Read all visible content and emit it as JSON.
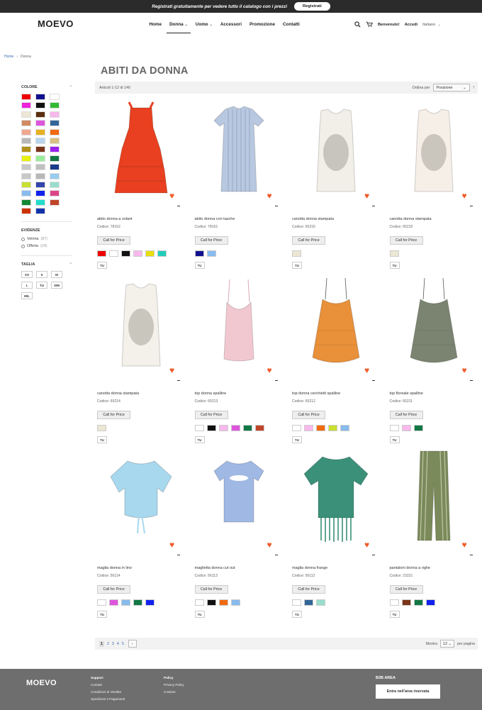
{
  "banner": {
    "text": "Registrati gratuitamente per vedere tutto il catalogo con i prezzi",
    "button": "Registrati"
  },
  "header": {
    "logo": "MOEVO",
    "nav": [
      "Home",
      "Donna",
      "Uomo",
      "Accessori",
      "Promozione",
      "Contatti"
    ],
    "welcome": "Benvenuto!",
    "login": "Accedi",
    "language": "Italiano"
  },
  "breadcrumb": {
    "home": "Home",
    "sep": "›",
    "current": "Donna"
  },
  "page_title": "ABITI DA DONNA",
  "toolbar": {
    "amount": "Articoli 1-12 di 140",
    "sort_label": "Ordina per",
    "sort_value": "Posizione"
  },
  "sidebar": {
    "colors_title": "COLORE",
    "colors": [
      "#ee0000",
      "#11118f",
      "#ffffff",
      "#ee22dd",
      "#111111",
      "#33bb33",
      "#ece6d4",
      "#5a2e0e",
      "#f7b8ec",
      "#d28a60",
      "#dd55dd",
      "#336699",
      "#f0a890",
      "#e8b020",
      "#f06a10",
      "#b8b8b8",
      "#b8d4ee",
      "#d8c080",
      "#b09018",
      "#7a3418",
      "#9922ee",
      "#e8f010",
      "#99ee99",
      "#117744",
      "#c8c8c8",
      "#c0c0c0",
      "#1a3a8a",
      "#c8c8c8",
      "#b8b8b8",
      "#99ccee",
      "#c8e030",
      "#3344aa",
      "#99ddcc",
      "#88bbee",
      "#1122ee",
      "#dd4488",
      "#118833",
      "#22ddcc",
      "#c04428",
      "#cc3300",
      "#1133aa"
    ],
    "evidence_title": "EVIDENZE",
    "evidence": [
      {
        "label": "Vetrina",
        "count": "(87)"
      },
      {
        "label": "Offerta",
        "count": "(24)"
      }
    ],
    "size_title": "TAGLIA",
    "sizes": [
      "XS",
      "S",
      "M",
      "L",
      "TU",
      "S/M",
      "M/L"
    ]
  },
  "cta_label": "Call for Price",
  "products": [
    {
      "name": "abito donna a volant",
      "code": "Codice: 78152",
      "colors": [
        "#ee0000",
        "#ffffff",
        "#111111",
        "#f7b8ec",
        "#e8e010",
        "#22ccbb"
      ],
      "size": "TU",
      "fill": "#e84020",
      "kind": "dress"
    },
    {
      "name": "abito donna con tasche",
      "code": "Codice: 78151",
      "colors": [
        "#11118f",
        "#88bbee"
      ],
      "size": "TU",
      "fill": "#b8c8e0",
      "kind": "tee-dress"
    },
    {
      "name": "canotta donna stampata",
      "code": "Codice: 65216",
      "colors": [
        "#ece6d4"
      ],
      "size": "TU",
      "fill": "#f2efe8",
      "kind": "tank"
    },
    {
      "name": "canotta donna stampata",
      "code": "Codice: 65215",
      "colors": [
        "#ece6d4"
      ],
      "size": "TU",
      "fill": "#f6efe8",
      "kind": "tank"
    },
    {
      "name": "canotta donna stampata",
      "code": "Codice: 65214",
      "colors": [
        "#ece6d4"
      ],
      "size": "TU",
      "fill": "#f4f0ea",
      "kind": "tank"
    },
    {
      "name": "top donna spalline",
      "code": "Codice: 65213",
      "colors": [
        "#ffffff",
        "#111111",
        "#f7b8ec",
        "#dd55dd",
        "#117744",
        "#c04428"
      ],
      "size": "TU",
      "fill": "#f2c8d0",
      "kind": "cami"
    },
    {
      "name": "top donna cerchietti spalline",
      "code": "Codice: 65212",
      "colors": [
        "#ffffff",
        "#f7b8ec",
        "#f06a10",
        "#c8e030",
        "#88bbee"
      ],
      "size": "TU",
      "fill": "#e8903a",
      "kind": "cami-wide"
    },
    {
      "name": "top floreale spalline",
      "code": "Codice: 65211",
      "colors": [
        "#ffffff",
        "#f7b8ec",
        "#117744"
      ],
      "size": "TU",
      "fill": "#7a8470",
      "kind": "cami-wide"
    },
    {
      "name": "maglia donna in lino",
      "code": "Codice: 56114",
      "colors": [
        "#ffffff",
        "#dd55dd",
        "#88bbee",
        "#117744",
        "#1122ee"
      ],
      "size": "TU",
      "fill": "#a8d8ee",
      "kind": "tee"
    },
    {
      "name": "maglietta donna cut out",
      "code": "Codice: 56113",
      "colors": [
        "#ffffff",
        "#111111",
        "#f06a10",
        "#88bbee"
      ],
      "size": "TU",
      "fill": "#a0b8e4",
      "kind": "tee-short"
    },
    {
      "name": "maglia donna frange",
      "code": "Codice: 56112",
      "colors": [
        "#ffffff",
        "#336699",
        "#99ddcc"
      ],
      "size": "TU",
      "fill": "#3a9078",
      "kind": "fringe"
    },
    {
      "name": "pantaloni donna a righe",
      "code": "Codice: 23221",
      "colors": [
        "#ffffff",
        "#7a3418",
        "#117744",
        "#1122ee"
      ],
      "size": "TU",
      "fill": "#7a8a5a",
      "kind": "pants"
    }
  ],
  "pager": {
    "pages": [
      "1",
      "2",
      "3",
      "4",
      "5"
    ],
    "next": "›",
    "limit_label": "Mostra",
    "limit_value": "12",
    "per_page": "per pagina"
  },
  "footer": {
    "logo": "MOEVO",
    "support_title": "Support",
    "support_links": [
      "Contatti",
      "Condizioni di Vendita",
      "Spedizioni e Pagamenti"
    ],
    "policy_title": "Policy",
    "policy_links": [
      "Privacy Policy",
      "Cookies"
    ],
    "b2b_title": "B2B AREA",
    "b2b_button": "Entra nell'area riservata"
  }
}
